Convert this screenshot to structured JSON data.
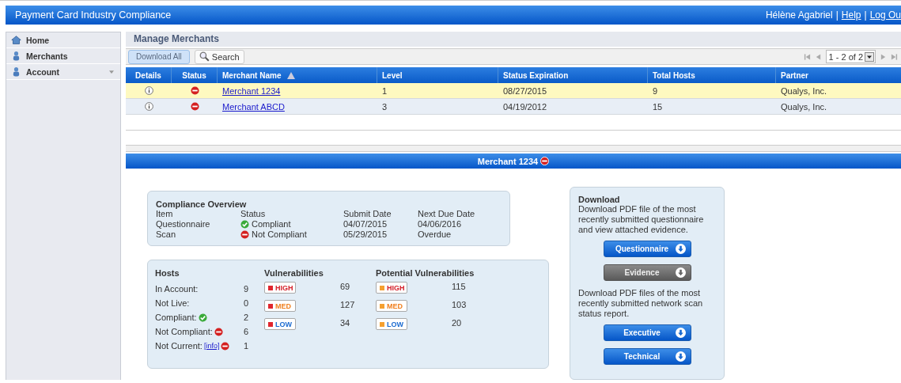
{
  "header": {
    "title": "Payment Card Industry Compliance",
    "user": "Hélène Agabriel",
    "separator": "|",
    "links": [
      "Help",
      "Log Ou"
    ]
  },
  "sidebar": {
    "items": [
      {
        "label": "Home",
        "kind": "home",
        "submenu": false
      },
      {
        "label": "Merchants",
        "kind": "person",
        "submenu": false
      },
      {
        "label": "Account",
        "kind": "person",
        "submenu": true
      }
    ]
  },
  "panel": {
    "title": "Manage Merchants"
  },
  "toolbar": {
    "download_button": "Download All",
    "search_button": "Search",
    "pager": "1 - 2 of 2"
  },
  "table": {
    "columns": [
      {
        "label": "Details",
        "kind": "plain"
      },
      {
        "label": "Status",
        "kind": "plain"
      },
      {
        "label": "Merchant Name",
        "kind": "sorted_asc"
      },
      {
        "label": "Level",
        "kind": "plain"
      },
      {
        "label": "Status Expiration",
        "kind": "plain"
      },
      {
        "label": "Total Hosts",
        "kind": "plain"
      },
      {
        "label": "Partner",
        "kind": "plain"
      }
    ],
    "rows": [
      {
        "selected": true,
        "kind": "not_compliant",
        "name": "Merchant 1234",
        "level": "1",
        "expiration": "08/27/2015",
        "hosts": "9",
        "partner": "Qualys, Inc."
      },
      {
        "selected": false,
        "kind": "not_compliant",
        "name": "Merchant ABCD",
        "level": "3",
        "expiration": "04/19/2012",
        "hosts": "15",
        "partner": "Qualys, Inc."
      }
    ]
  },
  "detail": {
    "title": "Merchant 1234",
    "kind": "not_compliant"
  },
  "compliance": {
    "title": "Compliance Overview",
    "columns": [
      "Item",
      "Status",
      "Submit Date",
      "Next Due Date"
    ],
    "rows": [
      {
        "item": "Questionnaire",
        "kind": "compliant",
        "status_label": "Compliant",
        "submit": "04/07/2015",
        "due": "04/06/2016"
      },
      {
        "item": "Scan",
        "kind": "not_compliant",
        "status_label": "Not Compliant",
        "submit": "05/29/2015",
        "due": "Overdue"
      }
    ]
  },
  "hosts": {
    "title": "Hosts",
    "rows": [
      {
        "label": "In Account:",
        "kind": "plain",
        "value": "9"
      },
      {
        "label": "Not Live:",
        "kind": "plain",
        "value": "0"
      },
      {
        "label": "Compliant:",
        "kind": "compliant",
        "value": "2"
      },
      {
        "label": "Not Compliant:",
        "kind": "not_compliant",
        "value": "6"
      },
      {
        "label": "Not Current:",
        "kind": "not_compliant",
        "link": "[info]",
        "value": "1"
      }
    ]
  },
  "vulnerabilities": [
    {
      "title": "Vulnerabilities",
      "kind": "confirmed",
      "levels": [
        {
          "label": "HIGH",
          "kind": "high",
          "value": "69"
        },
        {
          "label": "MED",
          "kind": "med",
          "value": "127"
        },
        {
          "label": "LOW",
          "kind": "low",
          "value": "34"
        }
      ]
    },
    {
      "title": "Potential Vulnerabilities",
      "kind": "potential",
      "levels": [
        {
          "label": "HIGH",
          "kind": "high",
          "value": "115"
        },
        {
          "label": "MED",
          "kind": "med",
          "value": "103"
        },
        {
          "label": "LOW",
          "kind": "low",
          "value": "20"
        }
      ]
    }
  ],
  "download": {
    "title": "Download",
    "text_1": "Download PDF file of the most recently submitted questionnaire and view attached evidence.",
    "buttons_1": [
      {
        "label": "Questionnaire",
        "disabled": false
      },
      {
        "label": "Evidence",
        "disabled": true
      }
    ],
    "text_2": "Download PDF files of the most recently submitted network scan status report.",
    "buttons_2": [
      {
        "label": "Executive",
        "disabled": false
      },
      {
        "label": "Technical",
        "disabled": false
      }
    ]
  }
}
